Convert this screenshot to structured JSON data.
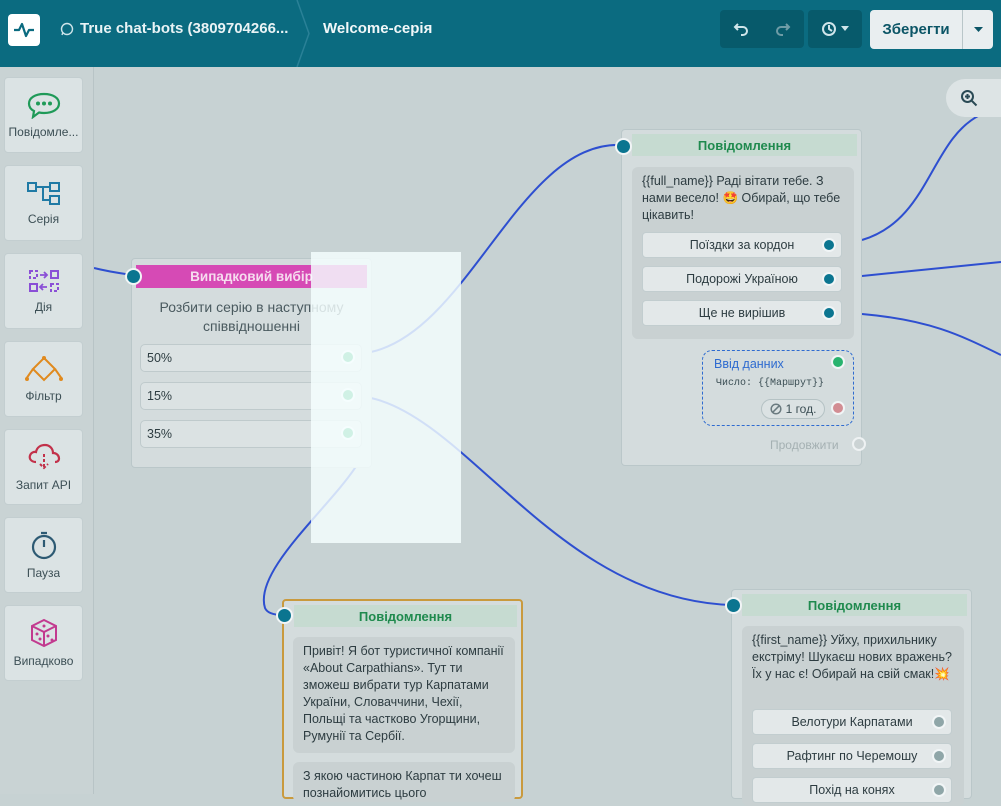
{
  "header": {
    "bot_name": "True chat-bots (3809704266...",
    "series_name": "Welcome-серія",
    "save_label": "Зберегти"
  },
  "sidebar": {
    "items": [
      {
        "label": "Повідомле...",
        "icon": "chat-bubble-icon"
      },
      {
        "label": "Серія",
        "icon": "flow-icon"
      },
      {
        "label": "Дія",
        "icon": "action-icon"
      },
      {
        "label": "Фільтр",
        "icon": "filter-icon"
      },
      {
        "label": "Запит API",
        "icon": "cloud-api-icon"
      },
      {
        "label": "Пауза",
        "icon": "stopwatch-icon"
      },
      {
        "label": "Випадково",
        "icon": "dice-icon"
      }
    ]
  },
  "random_node": {
    "title": "Випадковий вибір",
    "description": "Розбити серію в наступному співвідношенні",
    "options": [
      "50%",
      "15%",
      "35%"
    ]
  },
  "message_node_1": {
    "title": "Повідомлення",
    "text": "{{full_name}} Раді вітати тебе. З нами весело! 🤩 Обирай, що тебе цікавить!",
    "buttons": [
      "Поїздки за кордон",
      "Подорожі Україною",
      "Ще не вирішив"
    ],
    "input": {
      "title": "Ввід данних",
      "subtitle": "Число: {{Маршрут}}",
      "timeout": "1 год."
    },
    "continue_label": "Продовжити"
  },
  "message_node_2": {
    "title": "Повідомлення",
    "text1": "Привіт! Я бот туристичної компанії «About Carpathians». Тут ти зможеш вибрати тур Карпатами України, Словаччини, Чехії, Польщі та частково Угорщини, Румунії та Сербії.",
    "text2": "З якою частиною Карпат ти хочеш познайомитись цього"
  },
  "message_node_3": {
    "title": "Повідомлення",
    "text": "{{first_name}} Уйху, прихильнику екстріму! Шукаєш нових вражень? Їх у нас є! Обирай на свій смак!💥",
    "buttons": [
      "Велотури Карпатами",
      "Рафтинг по Черемошу",
      "Похід на конях"
    ]
  },
  "colors": {
    "topbar": "#0b6b80",
    "random_header": "#d948b8",
    "connector": "#2e4fd0",
    "node_title": "#1f8a4e"
  }
}
